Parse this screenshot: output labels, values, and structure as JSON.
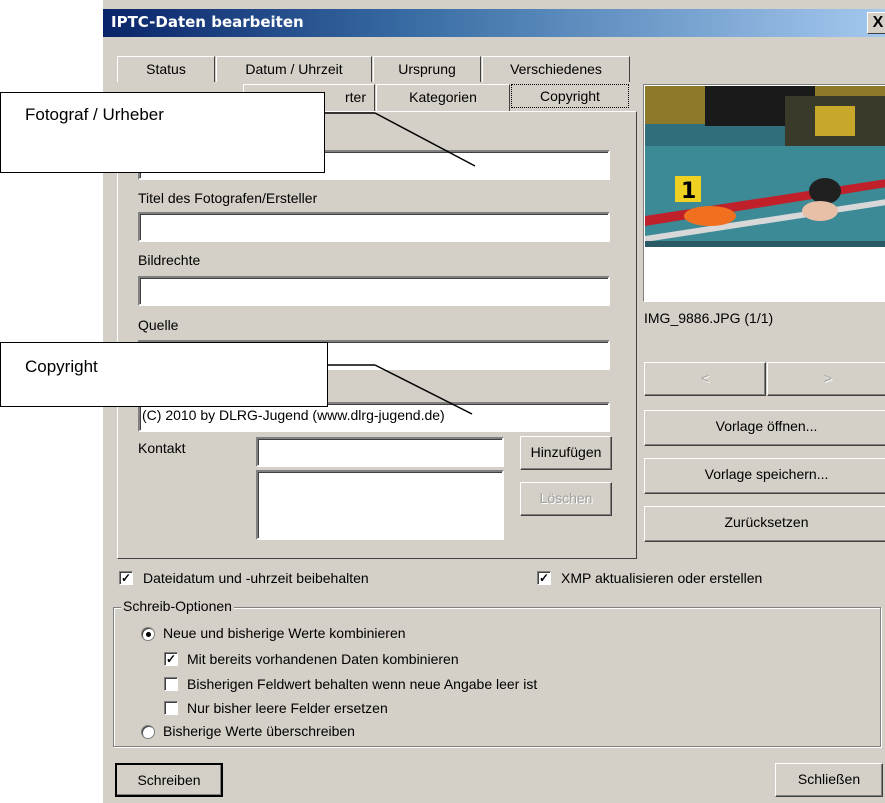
{
  "dialog": {
    "title": "IPTC-Daten bearbeiten",
    "close_label": "X"
  },
  "tabs_row1": [
    "Status",
    "Datum / Uhrzeit",
    "Ursprung",
    "Verschiedenes"
  ],
  "tabs_row2": [
    "Stichwörter",
    "Kategorien",
    "Copyright"
  ],
  "tabs_row2_partial": "rter",
  "fields": {
    "fotograf": {
      "value": ""
    },
    "titel": {
      "label": "Titel des Fotografen/Ersteller",
      "value": ""
    },
    "bildrechte": {
      "label": "Bildrechte",
      "value": ""
    },
    "quelle": {
      "label": "Quelle",
      "value": ""
    },
    "copyright": {
      "value": "(C) 2010 by DLRG-Jugend (www.dlrg-jugend.de)"
    },
    "kontakt": {
      "label": "Kontakt",
      "value": ""
    }
  },
  "buttons": {
    "hinzufuegen": "Hinzufügen",
    "loeschen": "Löschen",
    "prev": "<",
    "next": ">",
    "vorlage_oeffnen": "Vorlage öffnen...",
    "vorlage_speichern": "Vorlage speichern...",
    "zuruecksetzen": "Zurücksetzen",
    "schreiben": "Schreiben",
    "schliessen": "Schließen"
  },
  "preview": {
    "filename": "IMG_9886.JPG (1/1)"
  },
  "options": {
    "dateidatum": {
      "label": "Dateidatum und -uhrzeit beibehalten",
      "checked": true
    },
    "xmp": {
      "label": "XMP aktualisieren oder erstellen",
      "checked": true
    }
  },
  "schreib_optionen": {
    "title": "Schreib-Optionen",
    "radio_kombinieren": "Neue und bisherige Werte kombinieren",
    "chk_mit_vorhandenen": "Mit bereits vorhandenen Daten kombinieren",
    "chk_bisherigen_feldwert": "Bisherigen Feldwert behalten wenn neue Angabe leer ist",
    "chk_nur_leere": "Nur bisher leere Felder ersetzen",
    "radio_ueberschreiben": "Bisherige Werte überschreiben"
  },
  "callouts": {
    "fotograf": "Fotograf / Urheber",
    "copyright": "Copyright"
  }
}
